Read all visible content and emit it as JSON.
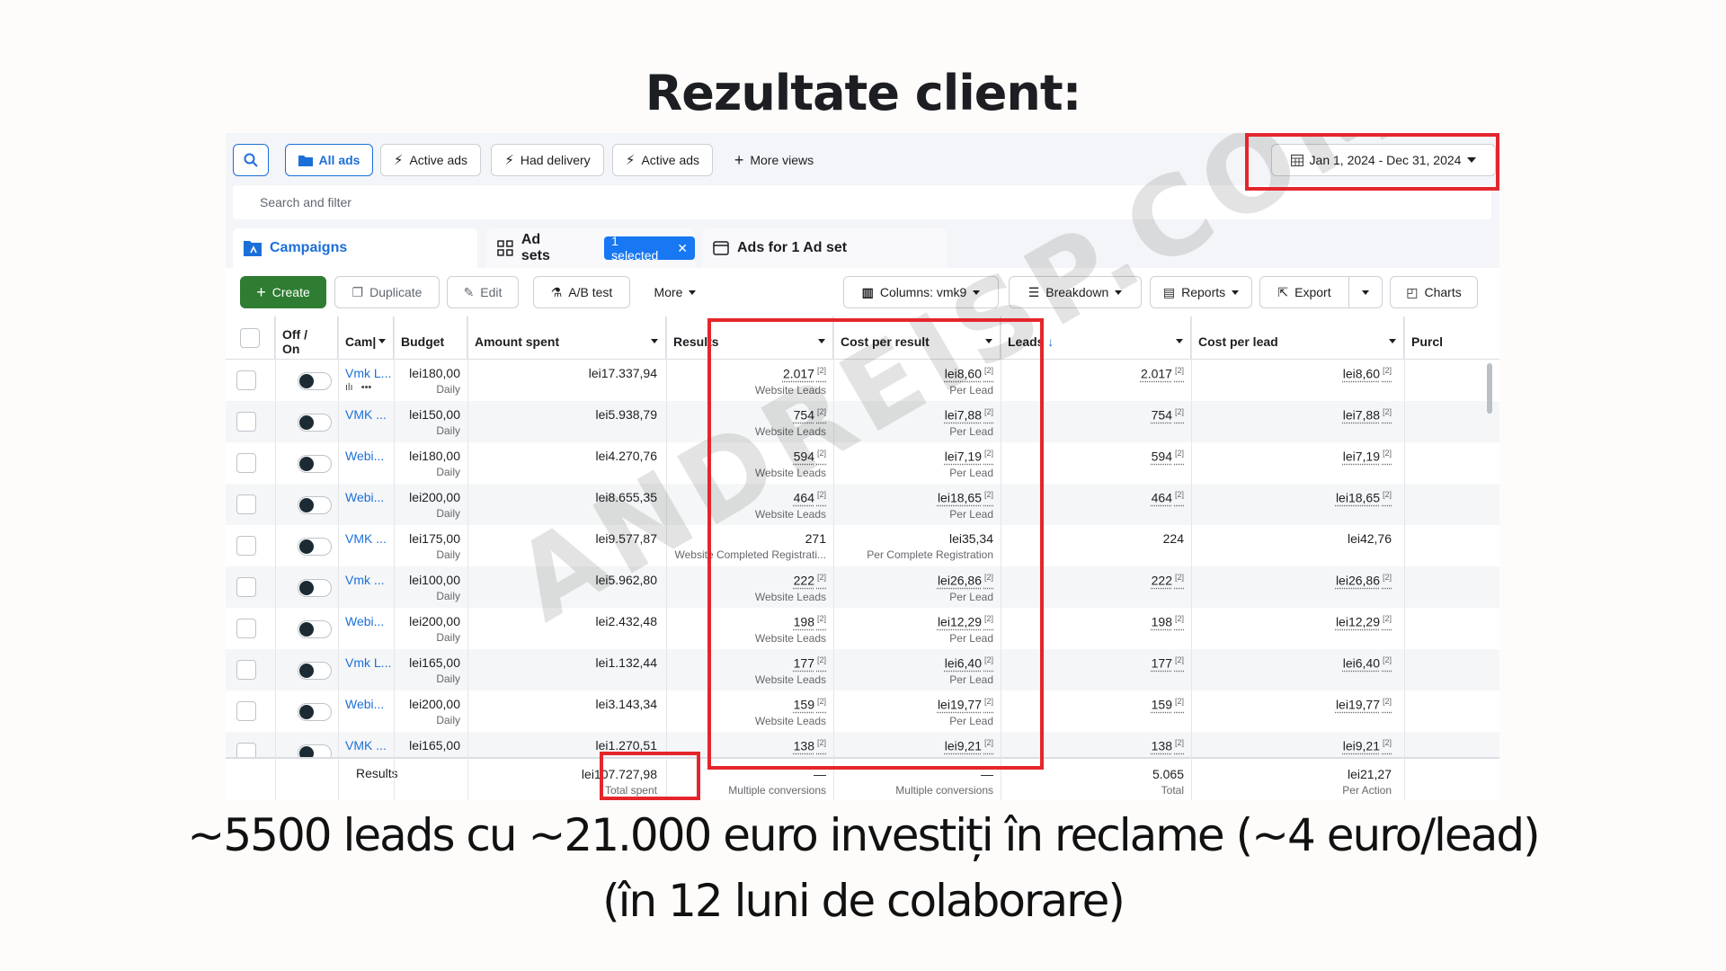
{
  "slide": {
    "heading": "Rezultate client:",
    "caption_line1": "~5500 leads cu ~21.000 euro investiți în reclame (~4 euro/lead)",
    "caption_line2": "(în 12 luni de colaborare)",
    "watermark": "ANDREISP.COM"
  },
  "topbar": {
    "views": [
      {
        "label": "All ads",
        "icon": "folder-icon"
      },
      {
        "label": "Active ads",
        "icon": "bolt-icon"
      },
      {
        "label": "Had delivery",
        "icon": "bolt-icon"
      },
      {
        "label": "Active ads",
        "icon": "bolt-icon"
      }
    ],
    "more_views": "More views",
    "date_range": "Jan 1, 2024 - Dec 31, 2024",
    "search_placeholder": "Search and filter"
  },
  "tabs": {
    "campaigns": "Campaigns",
    "ad_sets": "Ad sets",
    "selected": "1 selected",
    "ads": "Ads for 1 Ad set"
  },
  "toolbar": {
    "create": "Create",
    "duplicate": "Duplicate",
    "edit": "Edit",
    "ab_test": "A/B test",
    "more": "More",
    "columns": "Columns: vmk9",
    "breakdown": "Breakdown",
    "reports": "Reports",
    "export": "Export",
    "charts": "Charts"
  },
  "columns": {
    "off_on": "Off / On",
    "campaign": "Cam|",
    "budget": "Budget",
    "amount_spent": "Amount spent",
    "results": "Results",
    "cost_per_result": "Cost per result",
    "leads": "Leads",
    "cost_per_lead": "Cost per lead",
    "purchases": "Purcl"
  },
  "rows": [
    {
      "name": "Vmk L...",
      "budget": "lei180,00",
      "budget_type": "Daily",
      "spent": "lei17.337,94",
      "results": "2.017",
      "results_type": "Website Leads",
      "cpr": "lei8,60",
      "cpr_type": "Per Lead",
      "leads": "2.017",
      "cpl": "lei8,60"
    },
    {
      "name": "VMK ...",
      "budget": "lei150,00",
      "budget_type": "Daily",
      "spent": "lei5.938,79",
      "results": "754",
      "results_type": "Website Leads",
      "cpr": "lei7,88",
      "cpr_type": "Per Lead",
      "leads": "754",
      "cpl": "lei7,88"
    },
    {
      "name": "Webi...",
      "budget": "lei180,00",
      "budget_type": "Daily",
      "spent": "lei4.270,76",
      "results": "594",
      "results_type": "Website Leads",
      "cpr": "lei7,19",
      "cpr_type": "Per Lead",
      "leads": "594",
      "cpl": "lei7,19"
    },
    {
      "name": "Webi...",
      "budget": "lei200,00",
      "budget_type": "Daily",
      "spent": "lei8.655,35",
      "results": "464",
      "results_type": "Website Leads",
      "cpr": "lei18,65",
      "cpr_type": "Per Lead",
      "leads": "464",
      "cpl": "lei18,65"
    },
    {
      "name": "VMK ...",
      "budget": "lei175,00",
      "budget_type": "Daily",
      "spent": "lei9.577,87",
      "results": "271",
      "results_type": "Website Completed Registrati...",
      "cpr": "lei35,34",
      "cpr_type": "Per Complete Registration",
      "leads": "224",
      "cpl": "lei42,76"
    },
    {
      "name": "Vmk ...",
      "budget": "lei100,00",
      "budget_type": "Daily",
      "spent": "lei5.962,80",
      "results": "222",
      "results_type": "Website Leads",
      "cpr": "lei26,86",
      "cpr_type": "Per Lead",
      "leads": "222",
      "cpl": "lei26,86"
    },
    {
      "name": "Webi...",
      "budget": "lei200,00",
      "budget_type": "Daily",
      "spent": "lei2.432,48",
      "results": "198",
      "results_type": "Website Leads",
      "cpr": "lei12,29",
      "cpr_type": "Per Lead",
      "leads": "198",
      "cpl": "lei12,29"
    },
    {
      "name": "Vmk L...",
      "budget": "lei165,00",
      "budget_type": "Daily",
      "spent": "lei1.132,44",
      "results": "177",
      "results_type": "Website Leads",
      "cpr": "lei6,40",
      "cpr_type": "Per Lead",
      "leads": "177",
      "cpl": "lei6,40"
    },
    {
      "name": "Webi...",
      "budget": "lei200,00",
      "budget_type": "Daily",
      "spent": "lei3.143,34",
      "results": "159",
      "results_type": "Website Leads",
      "cpr": "lei19,77",
      "cpr_type": "Per Lead",
      "leads": "159",
      "cpl": "lei19,77"
    },
    {
      "name": "VMK ...",
      "budget": "lei165,00",
      "budget_type": "",
      "spent": "lei1.270,51",
      "results": "138",
      "results_type": "",
      "cpr": "lei9,21",
      "cpr_type": "",
      "leads": "138",
      "cpl": "lei9,21"
    }
  ],
  "totals": {
    "label": "Results",
    "spent": "lei107.727,98",
    "spent_sub": "Total spent",
    "results": "—",
    "results_sub": "Multiple conversions",
    "cpr": "—",
    "cpr_sub": "Multiple conversions",
    "leads": "5.065",
    "leads_sub": "Total",
    "cpl": "lei21,27",
    "cpl_sub": "Per Action"
  },
  "footnote_marker": "[2]",
  "colors": {
    "highlight": "#e4262c",
    "accent": "#1877f2",
    "create": "#2e7d32"
  }
}
